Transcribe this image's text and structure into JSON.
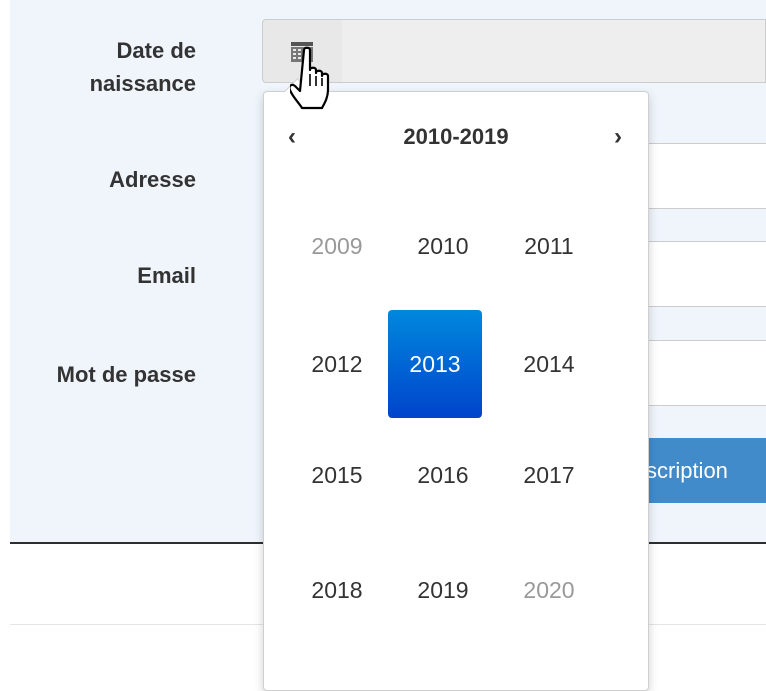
{
  "form": {
    "labels": {
      "birth_date_line1": "Date de",
      "birth_date_line2": "naissance",
      "address": "Adresse",
      "email": "Email",
      "password": "Mot de passe"
    },
    "submit_label": "scription",
    "submit_color": "#428bca"
  },
  "datepicker": {
    "decade": "2010-2019",
    "prev": "‹",
    "next": "›",
    "years": [
      {
        "label": "2009",
        "state": "old"
      },
      {
        "label": "2010",
        "state": "normal"
      },
      {
        "label": "2011",
        "state": "normal"
      },
      {
        "label": "2012",
        "state": "normal"
      },
      {
        "label": "2013",
        "state": "active"
      },
      {
        "label": "2014",
        "state": "normal"
      },
      {
        "label": "2015",
        "state": "normal"
      },
      {
        "label": "2016",
        "state": "normal"
      },
      {
        "label": "2017",
        "state": "normal"
      },
      {
        "label": "2018",
        "state": "normal"
      },
      {
        "label": "2019",
        "state": "normal"
      },
      {
        "label": "2020",
        "state": "new"
      }
    ],
    "active_color": "#0055cc"
  },
  "icons": {
    "calendar": "calendar-icon",
    "cursor": "hand-pointer-icon"
  }
}
